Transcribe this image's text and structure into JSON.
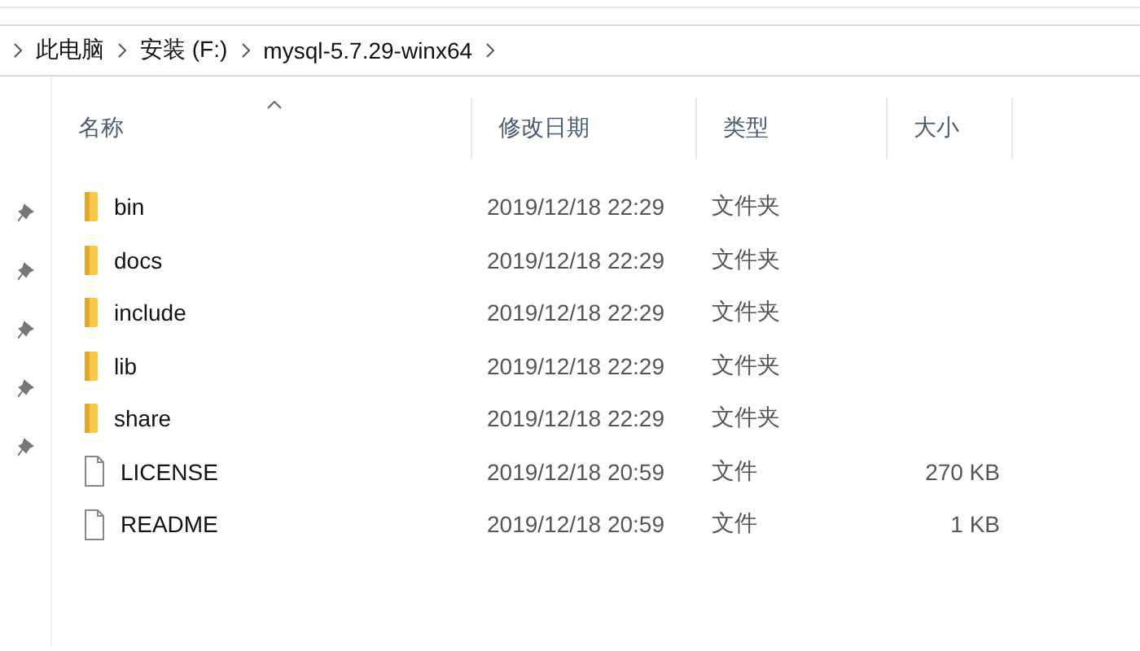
{
  "breadcrumb": [
    "此电脑",
    "安装 (F:)",
    "mysql-5.7.29-winx64"
  ],
  "columns": [
    "名称",
    "修改日期",
    "类型",
    "大小"
  ],
  "rows": [
    {
      "kind": "folder",
      "name": "bin",
      "date": "2019/12/18 22:29",
      "type": "文件夹"
    },
    {
      "kind": "folder",
      "name": "docs",
      "date": "2019/12/18 22:29",
      "type": "文件夹"
    },
    {
      "kind": "folder",
      "name": "include",
      "date": "2019/12/18 22:29",
      "type": "文件夹"
    },
    {
      "kind": "folder",
      "name": "lib",
      "date": "2019/12/18 22:29",
      "type": "文件夹"
    },
    {
      "kind": "folder",
      "name": "share",
      "date": "2019/12/18 22:29",
      "type": "文件夹"
    },
    {
      "kind": "file",
      "name": "LICENSE",
      "date": "2019/12/18 20:59",
      "type": "文件",
      "size": "270 KB"
    },
    {
      "kind": "file",
      "name": "README",
      "date": "2019/12/18 20:59",
      "type": "文件",
      "size": "1 KB"
    }
  ]
}
